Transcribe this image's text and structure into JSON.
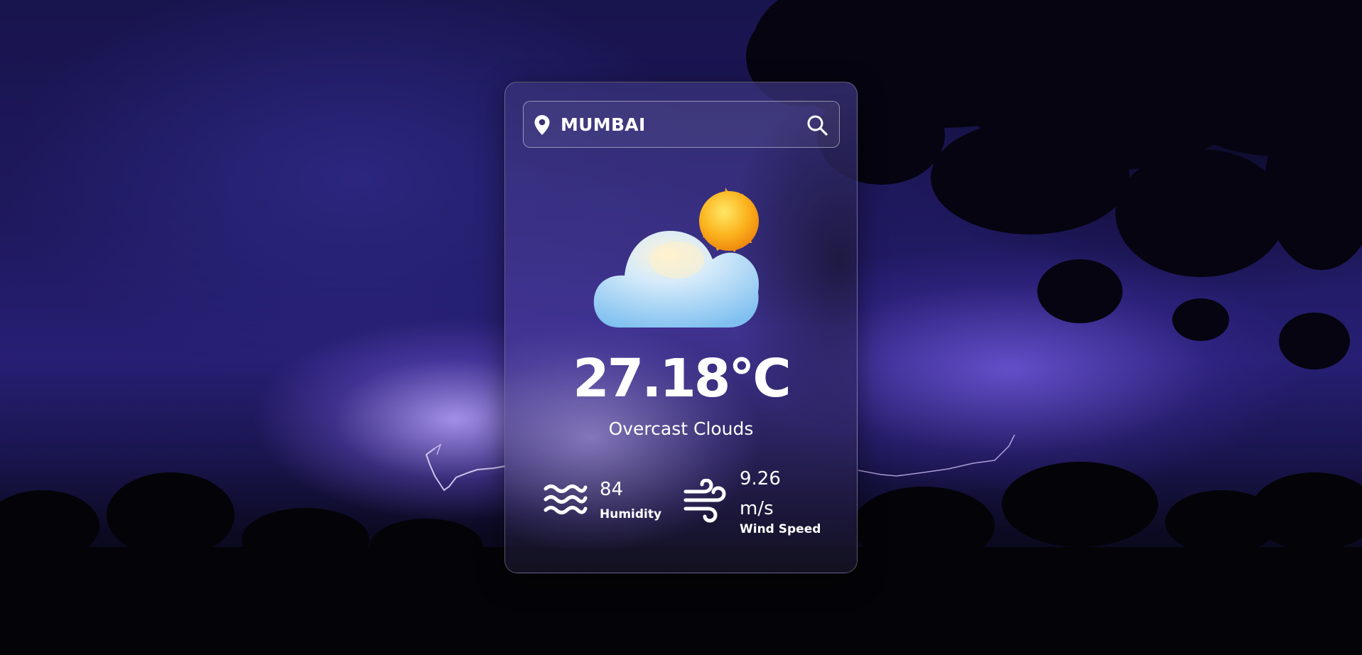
{
  "search": {
    "city": "MUMBAI",
    "pin_icon": "location-pin-icon",
    "search_icon": "magnifier-icon"
  },
  "weather": {
    "icon": "cloud-with-sun-icon",
    "temperature": "27.18°C",
    "condition": "Overcast Clouds"
  },
  "stats": {
    "humidity": {
      "icon": "waves-icon",
      "value": "84",
      "label": "Humidity"
    },
    "wind": {
      "icon": "wind-icon",
      "value": "9.26 m/s",
      "label": "Wind Speed"
    }
  },
  "colors": {
    "accent_text": "#ffffff",
    "sky": "#2f2487",
    "sun": "#fbb41f",
    "cloud": "#9fd2f5"
  }
}
